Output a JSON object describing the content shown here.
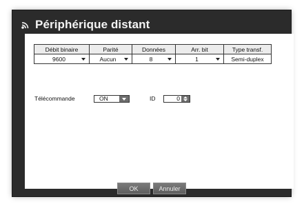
{
  "dialog": {
    "title": "Périphérique distant",
    "title_icon": "remote-signal-icon"
  },
  "settings_table": {
    "headers": [
      "Débit binaire",
      "Parité",
      "Données",
      "Arr. bit",
      "Type transf."
    ],
    "values": [
      "9600",
      "Aucun",
      "8",
      "1",
      "Semi-duplex"
    ]
  },
  "remote": {
    "label": "Télécommande",
    "value": "ON"
  },
  "id": {
    "label": "ID",
    "value": "0"
  },
  "buttons": {
    "ok": "OK",
    "cancel": "Annuler"
  },
  "colors": {
    "dialog_bg": "#2b2b2b",
    "panel_bg": "#ffffff",
    "button_bg": "#6d6d6d"
  }
}
